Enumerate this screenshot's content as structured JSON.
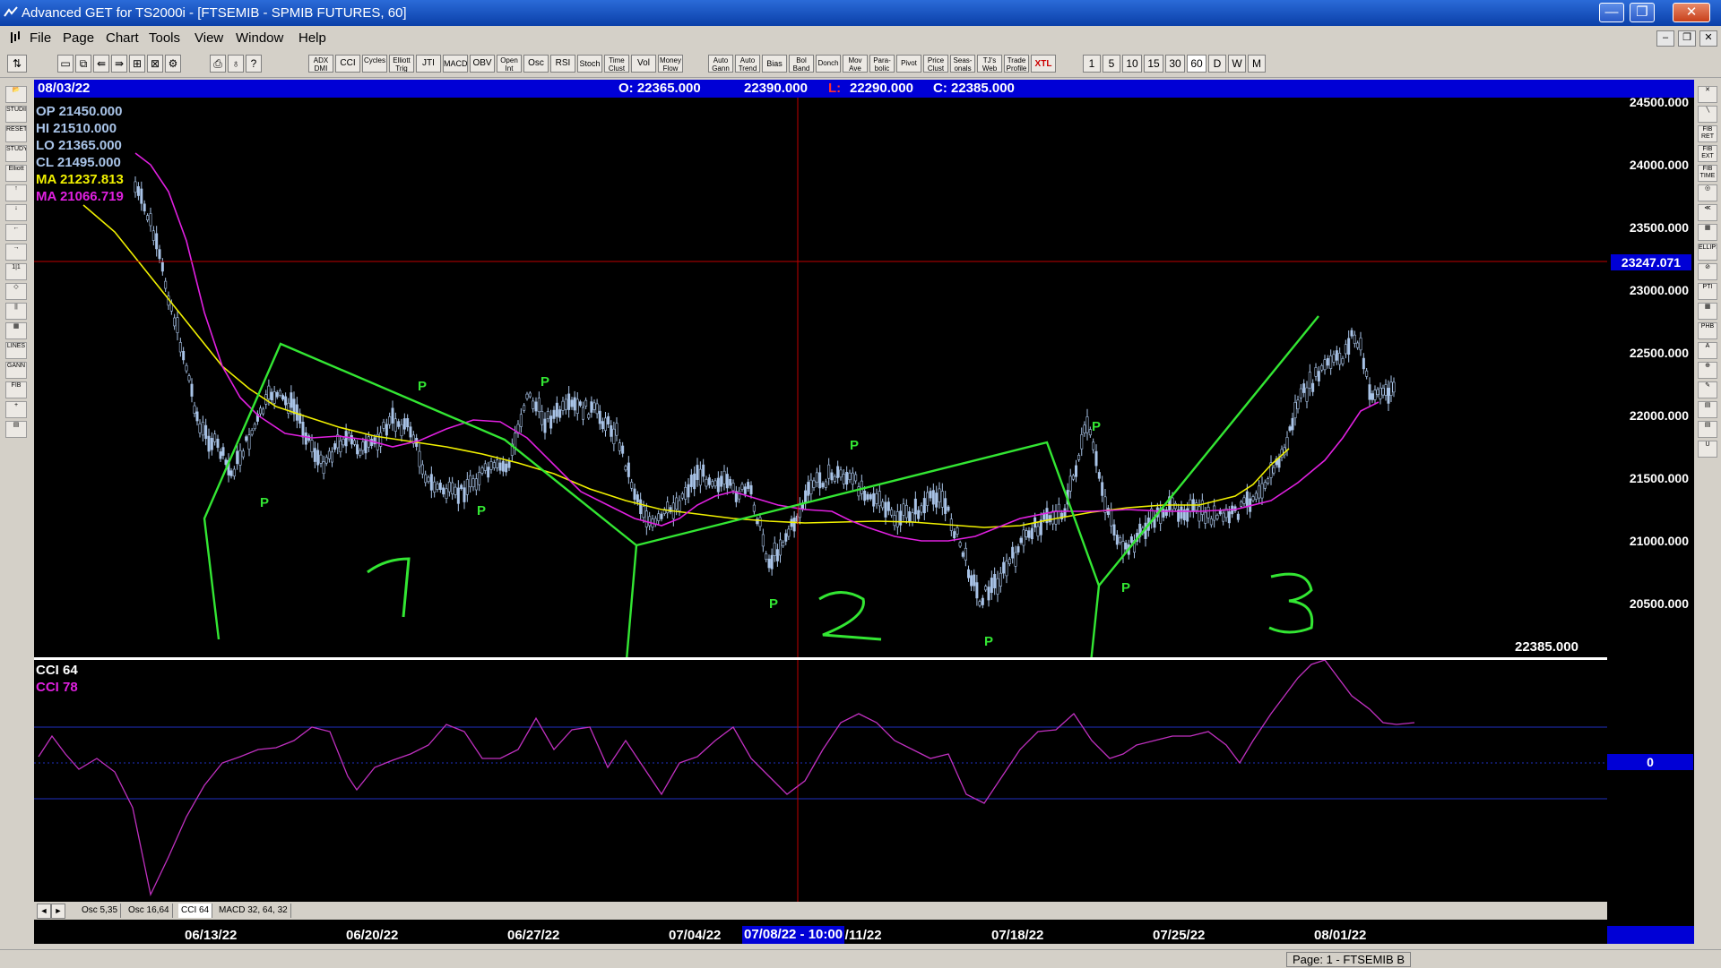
{
  "window": {
    "title": "Advanced GET for TS2000i - [FTSEMIB - SPMIB FUTURES, 60]",
    "minimize": "—",
    "maximize": "❐",
    "close": "✕"
  },
  "menu": {
    "items": [
      "File",
      "Page",
      "Chart",
      "Tools",
      "View",
      "Window",
      "Help"
    ],
    "mdi_min": "–",
    "mdi_restore": "❐",
    "mdi_close": "✕"
  },
  "toolbar": {
    "studies": [
      "ADX DMI",
      "CCI",
      "Cycles",
      "Elliott Trig",
      "JTI",
      "MACD",
      "OBV",
      "Open Int",
      "Osc",
      "RSI",
      "Stoch",
      "Time Clust",
      "Vol",
      "Money Flow",
      "Auto Gann",
      "Auto Trend",
      "Bias",
      "Bol Band",
      "Donch",
      "Mov Ave",
      "Para-bolic",
      "Pivot",
      "Price Clust",
      "Seas-onals",
      "TJ's Web",
      "Trade Profile",
      "XTL"
    ],
    "intervals": [
      "1",
      "5",
      "10",
      "15",
      "30",
      "60",
      "D",
      "W",
      "M"
    ],
    "selected_interval": "60"
  },
  "infobar": {
    "date": "08/03/22",
    "open": "O: 22365.000",
    "high": "22390.000",
    "low_prefix": "L:",
    "low": "22290.000",
    "close": "C: 22385.000"
  },
  "indicators": {
    "op": "OP  21450.000",
    "hi": "HI   21510.000",
    "lo": "LO  21365.000",
    "cl": "CL  21495.000",
    "ma1": "MA  21237.813",
    "ma2": "MA  21066.719",
    "cci64": "CCI 64",
    "cci78": "CCI  78"
  },
  "colors": {
    "background": "#000000",
    "candle": "#a9c4e8",
    "ma_yellow": "#f0f000",
    "ma_magenta": "#e020e0",
    "annotation_green": "#33e633",
    "crosshair": "#c00000",
    "info_blue": "#0000d6"
  },
  "price_axis": {
    "ticks": [
      "24500.000",
      "24000.000",
      "23500.000",
      "23000.000",
      "22500.000",
      "22000.000",
      "21500.000",
      "21000.000",
      "20500.000"
    ],
    "cursor_price": "23247.071",
    "last_price": "22385.000"
  },
  "cci_axis": {
    "zero_label": "0"
  },
  "annotations": {
    "pivots": [
      "P",
      "P",
      "P",
      "P",
      "P",
      "P",
      "P",
      "P",
      "P"
    ],
    "wave_labels": [
      "1",
      "2",
      "3"
    ]
  },
  "tabs": [
    "Osc 5,35",
    "Osc 16,64",
    "CCI 64",
    "MACD 32, 64, 32"
  ],
  "selected_tab": "CCI 64",
  "tab_arrows": [
    "◄",
    "►"
  ],
  "date_axis": {
    "labels": [
      "06/13/22",
      "06/20/22",
      "06/27/22",
      "07/04/22",
      "07/11/22",
      "07/18/22",
      "07/25/22",
      "08/01/22"
    ],
    "cursor_date": "07/08/22 - 10:00"
  },
  "status": {
    "text": "Page: 1 - FTSEMIB B"
  },
  "left_tools": [
    "📂",
    "STUDIES",
    "RESET",
    "STUDY",
    "Elliott",
    "↑",
    "↓",
    "←",
    "→",
    "1|1",
    "◇",
    "||",
    "▦",
    "LINES",
    "GANN",
    "FIB",
    "+",
    "▤"
  ],
  "right_tools": [
    "✕",
    "╲",
    "FIB RET",
    "FIB EXT",
    "FIB TIME",
    "◎",
    "≪",
    "▦",
    "ELLIPS",
    "⊘",
    "PTI",
    "▦",
    "PHB",
    "A",
    "⊕",
    "✎",
    "▤",
    "▤",
    "U"
  ]
}
